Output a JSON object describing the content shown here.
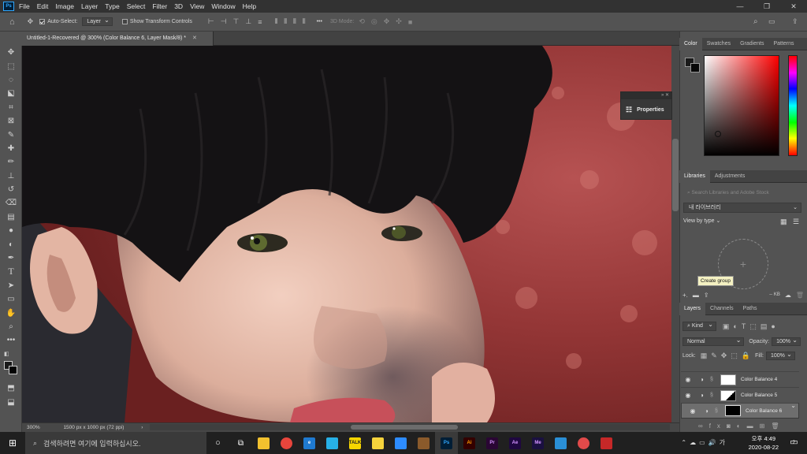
{
  "app": {
    "logo_text": "Ps"
  },
  "menu": [
    "File",
    "Edit",
    "Image",
    "Layer",
    "Type",
    "Select",
    "Filter",
    "3D",
    "View",
    "Window",
    "Help"
  ],
  "window_controls": [
    "—",
    "❐",
    "✕"
  ],
  "options_bar": {
    "auto_select_label": "Auto-Select:",
    "auto_select_value": "Layer",
    "show_transform_label": "Show Transform Controls",
    "more_label": "•••",
    "mode_3d_label": "3D Mode:"
  },
  "document_tab": {
    "title": "Untitled-1-Recovered @ 300% (Color Balance 6, Layer Mask/8) *"
  },
  "status_bar": {
    "zoom": "300%",
    "doc_size": "1500 px x 1000 px (72 ppi)",
    "arrow": "›"
  },
  "properties_panel": {
    "title": "Properties"
  },
  "color_panel": {
    "tabs": [
      "Color",
      "Swatches",
      "Gradients",
      "Patterns"
    ]
  },
  "libraries_panel": {
    "tabs": [
      "Libraries",
      "Adjustments"
    ],
    "search_placeholder": "Search Libraries and Adobe Stock",
    "library_name": "내 라이브러리",
    "view_by": "View by type",
    "tooltip": "Create group",
    "storage": "-- KB"
  },
  "layers_panel": {
    "tabs": [
      "Layers",
      "Channels",
      "Paths"
    ],
    "filter_kind": "Kind",
    "blend_mode": "Normal",
    "opacity_label": "Opacity:",
    "opacity_value": "100%",
    "lock_label": "Lock:",
    "fill_label": "Fill:",
    "fill_value": "100%",
    "layers": [
      {
        "name": "Color Balance 4",
        "mask_color": "#ffffff",
        "selected": false
      },
      {
        "name": "Color Balance 5",
        "mask_color": "#ffffff",
        "selected": false
      },
      {
        "name": "Color Balance 6",
        "mask_color": "#000000",
        "selected": true
      }
    ]
  },
  "taskbar": {
    "search_placeholder": "검색하려면 여기에 입력하십시오.",
    "apps": [
      {
        "name": "file-explorer",
        "label": "",
        "color": "#f2c12e"
      },
      {
        "name": "chrome",
        "label": "",
        "color": "#e8453c"
      },
      {
        "name": "edge",
        "label": "e",
        "color": "#1f7ad0"
      },
      {
        "name": "bird-app",
        "label": "",
        "color": "#27b0e6"
      },
      {
        "name": "kakaotalk",
        "label": "TALK",
        "color": "#f7d600"
      },
      {
        "name": "sticky-notes",
        "label": "",
        "color": "#f5d33c"
      },
      {
        "name": "zoom",
        "label": "",
        "color": "#2d8cff"
      },
      {
        "name": "game-app",
        "label": "",
        "color": "#8a5a2b"
      },
      {
        "name": "photoshop",
        "label": "Ps",
        "color": "#001e36"
      },
      {
        "name": "illustrator",
        "label": "Ai",
        "color": "#330000"
      },
      {
        "name": "premiere",
        "label": "Pr",
        "color": "#2a0634"
      },
      {
        "name": "after-effects",
        "label": "Ae",
        "color": "#1f0740"
      },
      {
        "name": "media-encoder",
        "label": "Me",
        "color": "#1a1040"
      },
      {
        "name": "store",
        "label": "",
        "color": "#2a8fd6"
      },
      {
        "name": "red-app",
        "label": "",
        "color": "#e24a4a"
      },
      {
        "name": "pdf-app",
        "label": "",
        "color": "#c62828"
      }
    ],
    "ime": "가",
    "time": "오후 4:49",
    "date": "2020-08-22",
    "notif_count": "2"
  }
}
